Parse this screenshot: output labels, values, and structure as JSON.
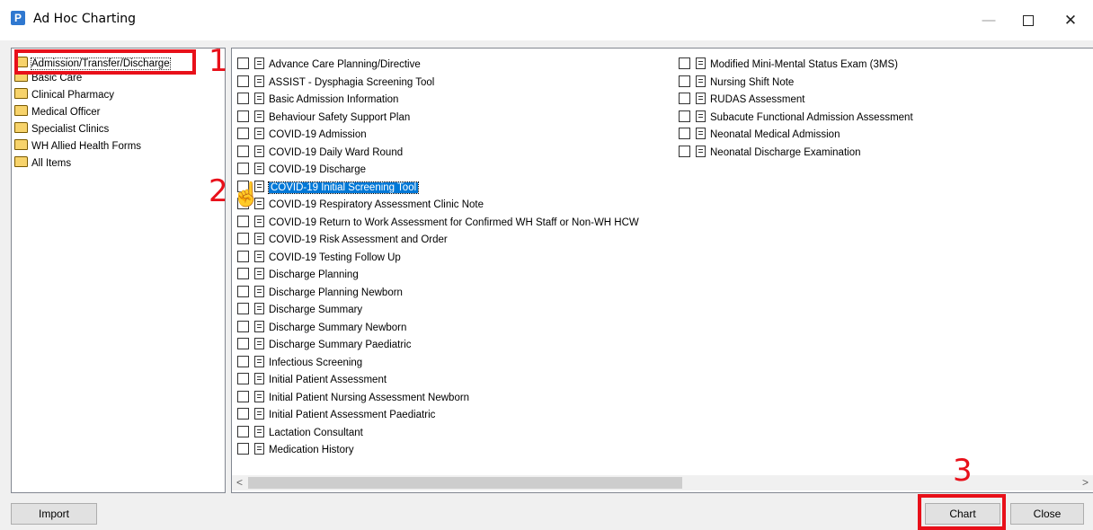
{
  "window": {
    "app_icon_letter": "P",
    "title": "Ad Hoc Charting",
    "minimize_glyph": "—",
    "close_glyph": "✕"
  },
  "categories": [
    {
      "label": "Admission/Transfer/Discharge",
      "selected": true
    },
    {
      "label": "Basic Care"
    },
    {
      "label": "Clinical Pharmacy"
    },
    {
      "label": "Medical Officer"
    },
    {
      "label": "Specialist Clinics"
    },
    {
      "label": "WH Allied Health Forms"
    },
    {
      "label": "All Items"
    }
  ],
  "forms_col1": [
    "Advance Care Planning/Directive",
    "ASSIST - Dysphagia Screening Tool",
    "Basic Admission Information",
    "Behaviour Safety Support Plan",
    "COVID-19 Admission",
    "COVID-19 Daily Ward Round",
    "COVID-19 Discharge",
    "COVID-19 Initial Screening Tool",
    "COVID-19 Respiratory Assessment Clinic Note",
    "COVID-19 Return to Work Assessment for Confirmed WH Staff or Non-WH HCW",
    "COVID-19 Risk Assessment and Order",
    "COVID-19 Testing Follow Up",
    "Discharge Planning",
    "Discharge Planning Newborn",
    "Discharge Summary",
    "Discharge Summary Newborn",
    "Discharge Summary Paediatric",
    "Infectious Screening",
    "Initial Patient Assessment",
    "Initial Patient Nursing Assessment Newborn",
    "Initial Patient Assessment Paediatric",
    "Lactation Consultant",
    "Medication History"
  ],
  "forms_col2": [
    "Modified Mini-Mental Status Exam (3MS)",
    "Nursing Shift Note",
    "RUDAS Assessment",
    "Subacute Functional Admission Assessment",
    "Neonatal Medical Admission",
    "Neonatal Discharge Examination"
  ],
  "highlighted_form": "COVID-19 Initial Screening Tool",
  "scrollbar": {
    "left_arrow": "<",
    "right_arrow": ">"
  },
  "buttons": {
    "import": "Import",
    "chart": "Chart",
    "close": "Close"
  },
  "annotations": {
    "step1": "1",
    "step2": "2",
    "step3": "3",
    "color": "#e8101a"
  }
}
